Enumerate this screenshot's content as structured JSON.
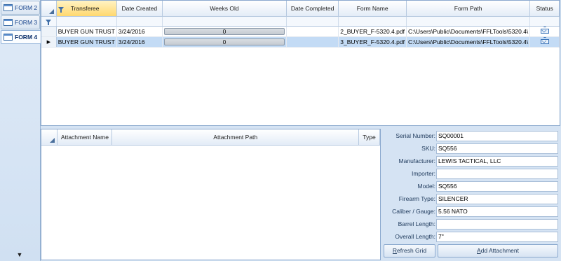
{
  "tabs": [
    {
      "label": "FORM 2",
      "active": false
    },
    {
      "label": "FORM 3",
      "active": false
    },
    {
      "label": "FORM 4",
      "active": true
    }
  ],
  "main_grid": {
    "columns": [
      "Transferee",
      "Date Created",
      "Weeks Old",
      "Date Completed",
      "Form Name",
      "Form Path",
      "Status"
    ],
    "rows": [
      {
        "transferee": "BUYER GUN TRUST",
        "date_created": "3/24/2016",
        "weeks_old": "0",
        "date_completed": "",
        "form_name": "2_BUYER_F-5320.4.pdf",
        "form_path": "C:\\Users\\Public\\Documents\\FFLTools\\5320.4\\",
        "status_icon": "envelope-upload-icon",
        "selected": false
      },
      {
        "transferee": "BUYER GUN TRUST",
        "date_created": "3/24/2016",
        "weeks_old": "0",
        "date_completed": "",
        "form_name": "3_BUYER_F-5320.4.pdf",
        "form_path": "C:\\Users\\Public\\Documents\\FFLTools\\5320.4\\",
        "status_icon": "envelope-upload-icon",
        "selected": true
      }
    ]
  },
  "attach_grid": {
    "columns": [
      "Attachment Name",
      "Attachment Path",
      "Type"
    ]
  },
  "details": {
    "fields": [
      {
        "label": "Serial Number:",
        "value": "SQ00001"
      },
      {
        "label": "SKU:",
        "value": "SQ556"
      },
      {
        "label": "Manufacturer:",
        "value": "LEWIS TACTICAL, LLC"
      },
      {
        "label": "Importer:",
        "value": ""
      },
      {
        "label": "Model:",
        "value": "SQ556"
      },
      {
        "label": "Firearm Type:",
        "value": "SILENCER"
      },
      {
        "label": "Caliber / Gauge:",
        "value": "5.56 NATO"
      },
      {
        "label": "Barrel Length:",
        "value": ""
      },
      {
        "label": "Overall Length:",
        "value": "7\""
      }
    ],
    "refresh_button": {
      "mnemonic": "R",
      "rest": "efresh Grid"
    },
    "add_attachment_button": {
      "mnemonic": "A",
      "rest": "dd Attachment"
    }
  },
  "colors": {
    "selected_row": "#c3dbf5",
    "sorted_header": "#ffd86e",
    "border": "#8ba9ce"
  }
}
